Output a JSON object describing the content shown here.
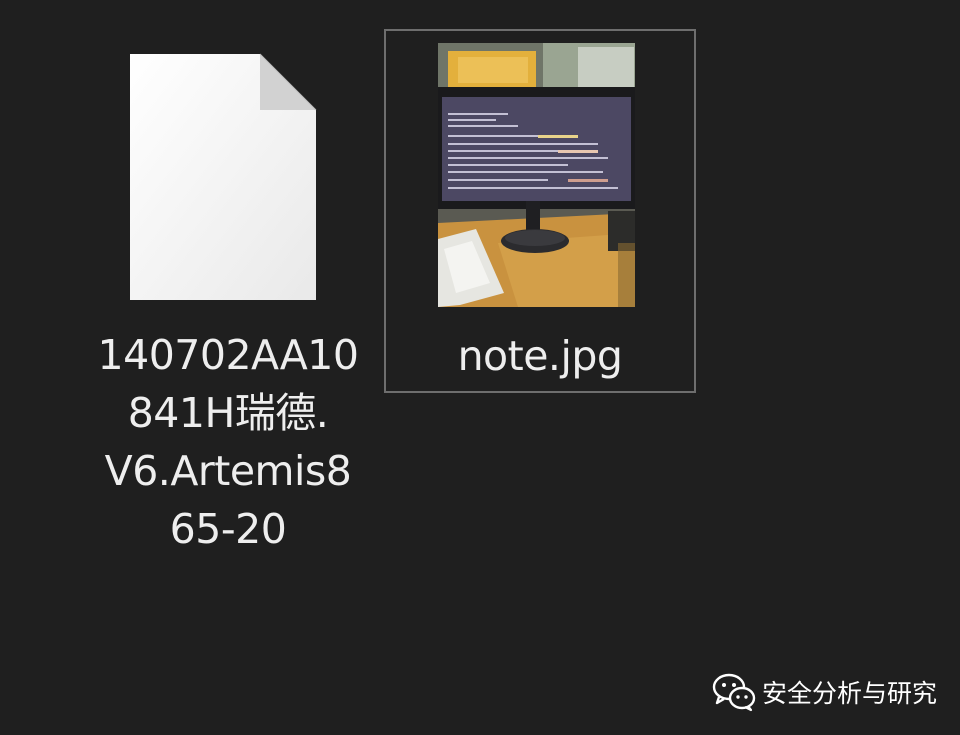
{
  "files": [
    {
      "name_lines": [
        "140702AA10",
        "841H瑞德.",
        "V6.Artemis8",
        "65-20"
      ],
      "icon": "blank-document-icon"
    },
    {
      "name": "note.jpg",
      "icon": "image-thumbnail",
      "state": "hover"
    }
  ],
  "watermark": {
    "icon": "wechat-icon",
    "text": "安全分析与研究"
  },
  "colors": {
    "background": "#1f1f1f",
    "hover_border": "#6e6e6e",
    "text": "#eeeeee"
  }
}
